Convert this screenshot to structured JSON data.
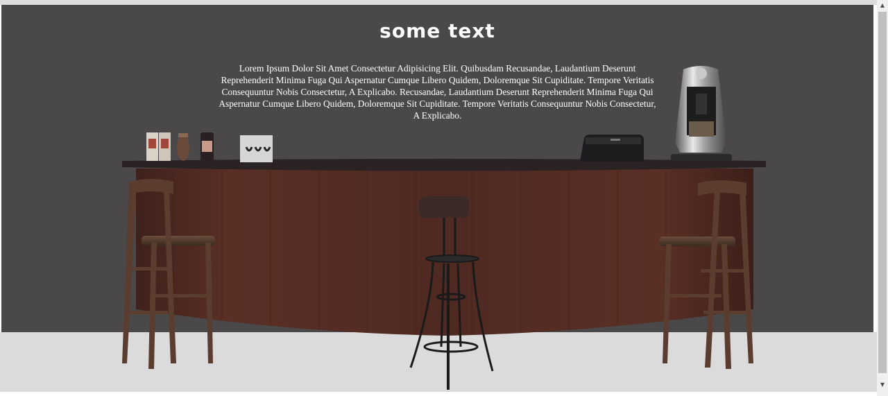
{
  "page": {
    "title": "some text",
    "paragraph": "Lorem Ipsum Dolor Sit Amet Consectetur Adipisicing Elit. Quibusdam Recusandae, Laudantium Deserunt Reprehenderit Minima Fuga Qui Aspernatur Cumque Libero Quidem, Doloremque Sit Cupiditate. Tempore Veritatis Consequuntur Nobis Consectetur, A Explicabo. Recusandae, Laudantium Deserunt Reprehenderit Minima Fuga Qui Aspernatur Cumque Libero Quidem, Doloremque Sit Cupiditate. Tempore Veritatis Consequuntur Nobis Consectetur, A Explicabo."
  },
  "colors": {
    "stage_background": "#4a4849",
    "floor": "#dbdbdb",
    "counter_wood": "#4e2a22",
    "counter_top": "#2a2222",
    "text": "#ffffff"
  },
  "scene": {
    "items": [
      "coffee-cups-icon",
      "jar-icon",
      "bottle-icon",
      "capsule-pack-icon",
      "cash-register-icon",
      "espresso-machine-icon",
      "bar-stool-icon"
    ]
  },
  "scrollbar": {
    "up_arrow": "▲",
    "down_arrow": "▼"
  }
}
